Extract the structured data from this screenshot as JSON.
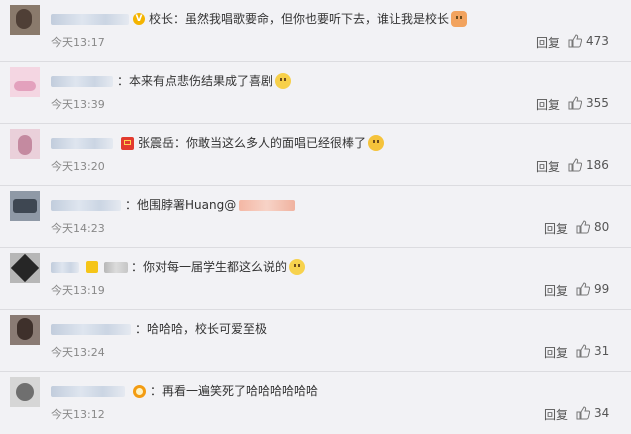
{
  "comments": [
    {
      "badge": "v-gold",
      "role_prefix": "校长",
      "body": "：虽然我唱歌要命，但你也要听下去，谁让我是校长",
      "emoji": "cat-emoji",
      "time": "今天13:17",
      "reply": "回复",
      "likes": "473",
      "avatar_colors": [
        "#6b5a4e",
        "#b8a89a"
      ]
    },
    {
      "badge": "",
      "body": "：本来有点悲伤结果成了喜剧",
      "emoji": "smile-emoji",
      "time": "今天13:39",
      "reply": "回复",
      "likes": "355",
      "avatar_colors": [
        "#f0c7d8",
        "#e6a6c2"
      ]
    },
    {
      "badge": "red-badge",
      "body": "张震岳：你敢当这么多人的面唱已经很棒了",
      "emoji": "laugh-emoji",
      "time": "今天13:20",
      "reply": "回复",
      "likes": "186",
      "avatar_colors": [
        "#e8b9c8",
        "#caa3b5"
      ]
    },
    {
      "badge": "",
      "body": "：他围脖署Huang@",
      "mention_suffix": "",
      "time": "今天14:23",
      "reply": "回复",
      "likes": "80",
      "avatar_colors": [
        "#5b6470",
        "#a7aeb8"
      ]
    },
    {
      "badge": "yellow-badge",
      "body": "：你对每一届学生都这么说的",
      "emoji": "moon-emoji",
      "time": "今天13:19",
      "reply": "回复",
      "likes": "99",
      "avatar_colors": [
        "#2d2d2d",
        "#9a9a9a"
      ]
    },
    {
      "badge": "",
      "body": "：哈哈哈，校长可爱至极",
      "time": "今天13:24",
      "reply": "回复",
      "likes": "31",
      "avatar_colors": [
        "#4a3b36",
        "#9b8c86"
      ]
    },
    {
      "badge": "crown-badge",
      "body": "：再看一遍笑死了哈哈哈哈哈哈",
      "time": "今天13:12",
      "reply": "回复",
      "likes": "34",
      "avatar_colors": [
        "#7d7d7d",
        "#d8d8d8"
      ]
    }
  ],
  "colors": {
    "background": "#f2f2f5",
    "text": "#333333",
    "time": "#888888",
    "mention": "#eb7350"
  }
}
